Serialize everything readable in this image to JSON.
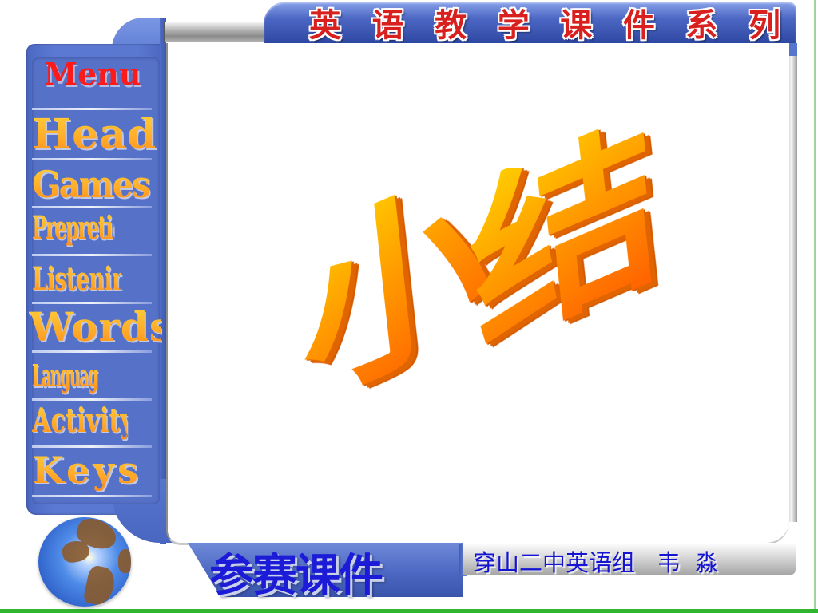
{
  "header": {
    "title_chars": [
      "英",
      "语",
      "教",
      "学",
      "课",
      "件",
      "系",
      "列"
    ],
    "title": "英语教学课件系列",
    "title_color": "#d8201f"
  },
  "sidebar": {
    "menu_title": "Menu",
    "menu_title_color": "#ff1a1a",
    "items": [
      {
        "label": "Head"
      },
      {
        "label": "Games"
      },
      {
        "label": "Prepretion"
      },
      {
        "label": "Listening"
      },
      {
        "label": "Words"
      },
      {
        "label": "Language Notes"
      },
      {
        "label": "Activity"
      },
      {
        "label": "Keys"
      }
    ],
    "item_color": "#ffb12c",
    "frame_color": "#5672c8"
  },
  "main": {
    "slide_title_chars": [
      "小",
      "结"
    ],
    "slide_title": "小结",
    "slide_title_color": "#ff8c00"
  },
  "footer": {
    "banner_text": "参赛课件",
    "credit": "穿山二中英语组   韦  淼",
    "text_color": "#1b1bd8",
    "globe_icon": "globe-icon"
  }
}
